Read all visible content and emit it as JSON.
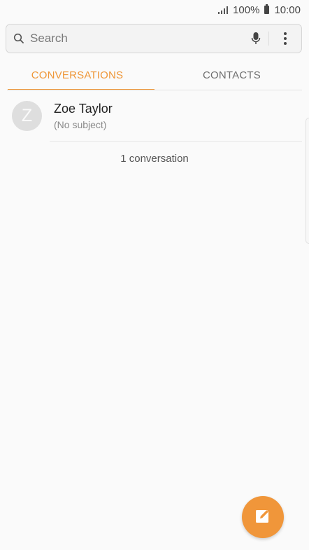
{
  "status_bar": {
    "battery_percent": "100%",
    "time": "10:00",
    "icons": [
      "signal-icon",
      "battery-icon"
    ]
  },
  "search": {
    "placeholder": "Search",
    "icons": [
      "search-icon",
      "microphone-icon",
      "more-options-icon"
    ]
  },
  "tabs": [
    {
      "label": "CONVERSATIONS",
      "active": true
    },
    {
      "label": "CONTACTS",
      "active": false
    }
  ],
  "conversations": [
    {
      "initial": "Z",
      "name": "Zoe Taylor",
      "subject": "(No subject)"
    }
  ],
  "conversation_count": "1 conversation",
  "fab": {
    "icon": "compose-icon"
  },
  "colors": {
    "accent": "#ef9637",
    "background": "#fafafa",
    "avatar": "#dedede"
  }
}
